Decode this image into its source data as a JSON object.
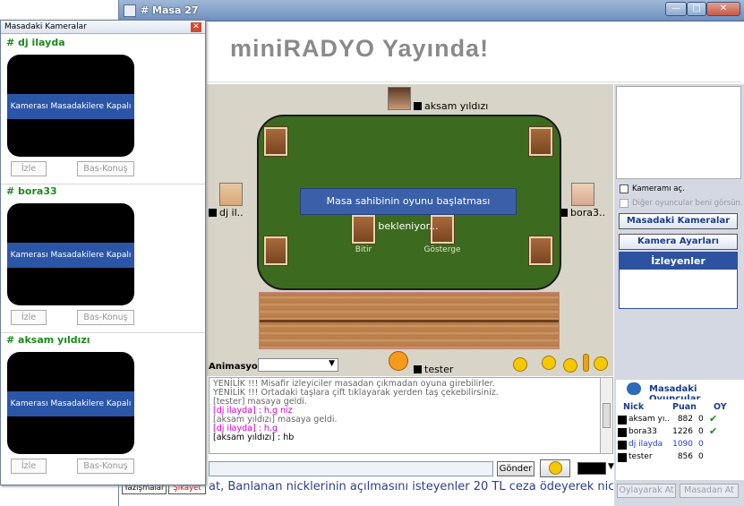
{
  "window": {
    "title": "# Masa 27",
    "minimize": "—",
    "maximize": "□",
    "close": "✕"
  },
  "banner": "miniRADYO Yayında!",
  "players_seat": {
    "top": "aksam yıldızı",
    "left": "dj il..",
    "right": "bora3..",
    "bottom": "tester"
  },
  "table": {
    "wait_message": "Masa sahibinin oyunu başlatması bekleniyor...",
    "bitir": "Bitir",
    "gosterge": "Gösterge"
  },
  "animation": {
    "label": "Animasyon",
    "selected": ""
  },
  "chat": {
    "lines": [
      {
        "text": "YENİLİK !!! Misafir izleyiciler masadan çıkmadan oyuna girebilirler.",
        "style": "l-sys"
      },
      {
        "text": "YENİLİK !!! Ortadaki taşlara çift tıklayarak yerden taş çekebilirsiniz.",
        "style": "l-sys"
      },
      {
        "text": "[tester] masaya geldi.",
        "style": "l-grey"
      },
      {
        "text": "[dj ilayda] : h.g niz",
        "style": "l-pink"
      },
      {
        "text": "[aksam yıldızı] masaya geldi.",
        "style": "l-grey"
      },
      {
        "text": "[dj ilayda] : h.g",
        "style": "l-pink"
      },
      {
        "text": "[aksam yıldızı] : hb",
        "style": "l-blk"
      }
    ],
    "input_value": "",
    "send": "Gönder",
    "ticker": "at, Banlanan nicklerinin açılmasını isteyenler 20 TL ceza ödeyerek nick"
  },
  "right": {
    "camera_on": "Kameramı aç.",
    "others_see": "Diğer oyuncular beni görsün.",
    "table_cams": "Masadaki Kameralar",
    "cam_settings": "Kamera Ayarları",
    "watchers": "İzleyenler",
    "players_title": "Masadaki Oyuncular",
    "col_nick": "Nick",
    "col_puan": "Puan",
    "col_oy": "OY",
    "players": [
      {
        "nick": "aksam yı...",
        "puan": "882",
        "oy": "0",
        "check": "✔",
        "color": "#000"
      },
      {
        "nick": "bora33",
        "puan": "1226",
        "oy": "0",
        "check": "✔",
        "color": "#000"
      },
      {
        "nick": "dj ilayda",
        "puan": "1090",
        "oy": "0",
        "check": "",
        "color": "#1a3dd8"
      },
      {
        "nick": "tester",
        "puan": "856",
        "oy": "0",
        "check": "",
        "color": "#000"
      }
    ],
    "btn_oylayarak": "Oylayarak At",
    "btn_masadan": "Masadan At"
  },
  "campanel": {
    "title": "Masadaki Kameralar",
    "close": "✕",
    "sections": [
      {
        "name": "# dj ilayda",
        "status": "Kamerası Masadakilere Kapalı",
        "watch": "İzle",
        "talk": "Bas-Konuş"
      },
      {
        "name": "# bora33",
        "status": "Kamerası Masadakilere Kapalı",
        "watch": "İzle",
        "talk": "Bas-Konuş"
      },
      {
        "name": "# aksam yıldızı",
        "status": "Kamerası Masadakilere Kapalı",
        "watch": "İzle",
        "talk": "Bas-Konuş"
      }
    ]
  },
  "bottom_tabs": {
    "yazismalar": "Yazışmalar",
    "sikayet": "Şikayet"
  }
}
